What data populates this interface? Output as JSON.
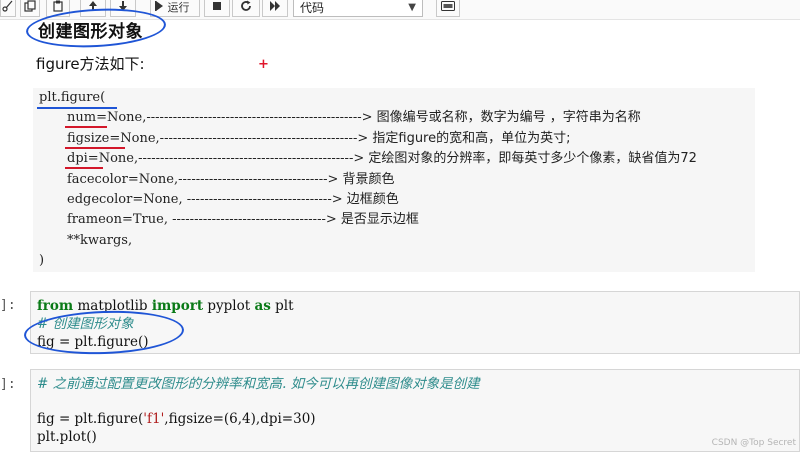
{
  "toolbar": {
    "run_label": "运行",
    "cell_type_value": "代码"
  },
  "heading": "创建图形对象",
  "intro": "figure方法如下:",
  "signature": {
    "open": "plt.figure(",
    "params": [
      {
        "code": "num=None,",
        "dashes": "-------------------------------------------------> ",
        "desc": "图像编号或名称，数字为编号 ，字符串为名称"
      },
      {
        "code": "figsize=None,",
        "dashes": "---------------------------------------------> ",
        "desc": "指定figure的宽和高，单位为英寸;"
      },
      {
        "code": "dpi=None,",
        "dashes": "-------------------------------------------------> ",
        "desc": "定绘图对象的分辨率，即每英寸多少个像素，缺省值为72"
      },
      {
        "code": "facecolor=None,",
        "dashes": "----------------------------------> ",
        "desc": "背景颜色"
      },
      {
        "code": "edgecolor=None, ",
        "dashes": "---------------------------------> ",
        "desc": "边框颜色"
      },
      {
        "code": "frameon=True, ",
        "dashes": "-----------------------------------> ",
        "desc": "是否显示边框"
      },
      {
        "code": "**kwargs,",
        "dashes": "",
        "desc": ""
      }
    ],
    "close": ")"
  },
  "cell1": {
    "prompt": "]:",
    "line1": {
      "kw1": "from",
      "mod": " matplotlib ",
      "kw2": "import",
      "rest": " pyplot ",
      "kw3": "as",
      "alias": " plt"
    },
    "comment": "# 创建图形对象",
    "line3": "fig = plt.figure()"
  },
  "cell2": {
    "prompt": "]:",
    "comment": "# 之前通过配置更改图形的分辨率和宽高. 如今可以再创建图像对象是创建",
    "line3_a": "fig = plt.figure(",
    "line3_str": "'f1'",
    "line3_b": ",figsize=(6,4),dpi=30)",
    "line4": "plt.plot()"
  },
  "watermark": "CSDN @Top Secret"
}
